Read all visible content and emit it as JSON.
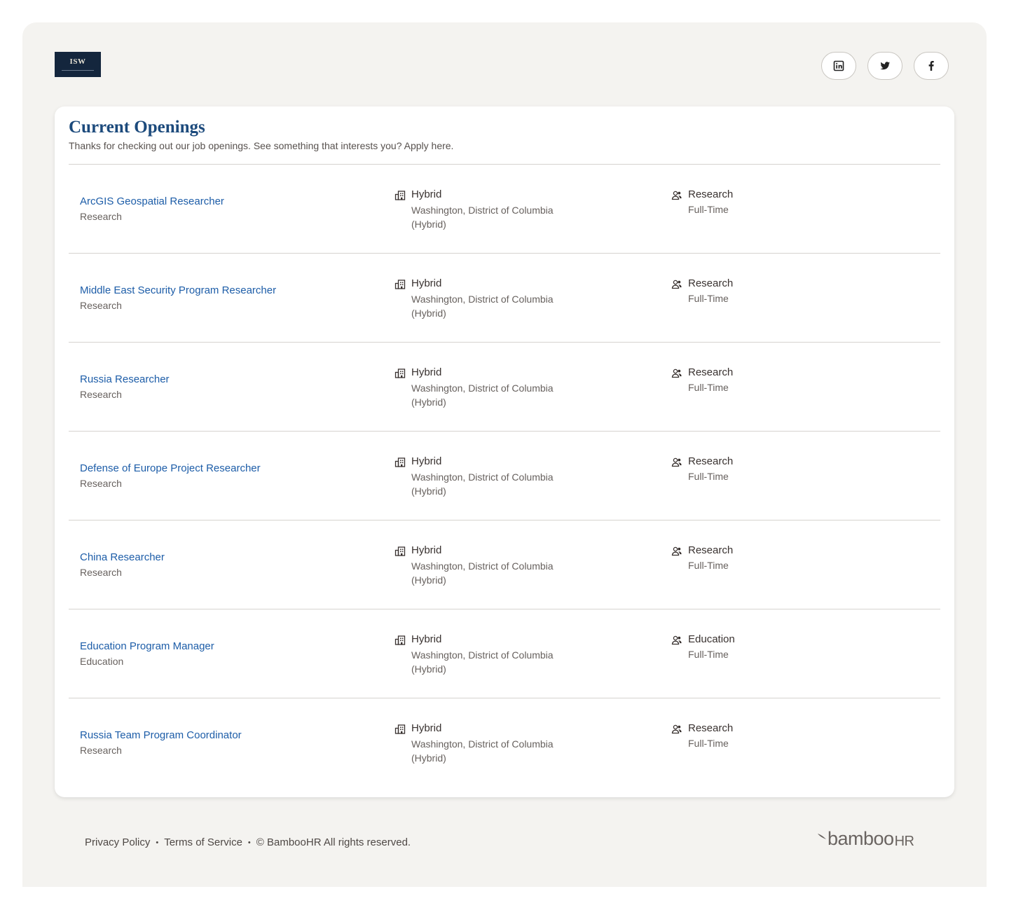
{
  "header": {
    "logo_text": "ISW",
    "social": [
      {
        "name": "LinkedIn",
        "icon": "linkedin-icon"
      },
      {
        "name": "Twitter",
        "icon": "twitter-icon"
      },
      {
        "name": "Facebook",
        "icon": "facebook-icon"
      }
    ]
  },
  "openings": {
    "title": "Current Openings",
    "subtitle": "Thanks for checking out our job openings. See something that interests you? Apply here.",
    "jobs": [
      {
        "title": "ArcGIS Geospatial Researcher",
        "department": "Research",
        "location_type": "Hybrid",
        "location": "Washington, District of Columbia (Hybrid)",
        "team": "Research",
        "employment": "Full-Time"
      },
      {
        "title": "Middle East Security Program Researcher",
        "department": "Research",
        "location_type": "Hybrid",
        "location": "Washington, District of Columbia (Hybrid)",
        "team": "Research",
        "employment": "Full-Time"
      },
      {
        "title": "Russia Researcher",
        "department": "Research",
        "location_type": "Hybrid",
        "location": "Washington, District of Columbia (Hybrid)",
        "team": "Research",
        "employment": "Full-Time"
      },
      {
        "title": "Defense of Europe Project Researcher",
        "department": "Research",
        "location_type": "Hybrid",
        "location": "Washington, District of Columbia (Hybrid)",
        "team": "Research",
        "employment": "Full-Time"
      },
      {
        "title": "China Researcher",
        "department": "Research",
        "location_type": "Hybrid",
        "location": "Washington, District of Columbia (Hybrid)",
        "team": "Research",
        "employment": "Full-Time"
      },
      {
        "title": "Education Program Manager",
        "department": "Education",
        "location_type": "Hybrid",
        "location": "Washington, District of Columbia (Hybrid)",
        "team": "Education",
        "employment": "Full-Time"
      },
      {
        "title": "Russia Team Program Coordinator",
        "department": "Research",
        "location_type": "Hybrid",
        "location": "Washington, District of Columbia (Hybrid)",
        "team": "Research",
        "employment": "Full-Time"
      }
    ]
  },
  "footer": {
    "privacy": "Privacy Policy",
    "separator": "•",
    "terms": "Terms of Service",
    "copyright": "© BambooHR All rights reserved.",
    "brand": "bamboo",
    "brand_suffix": "HR"
  },
  "colors": {
    "accent": "#1d5da8",
    "title": "#1c4a7c",
    "background": "#f4f3f0"
  }
}
